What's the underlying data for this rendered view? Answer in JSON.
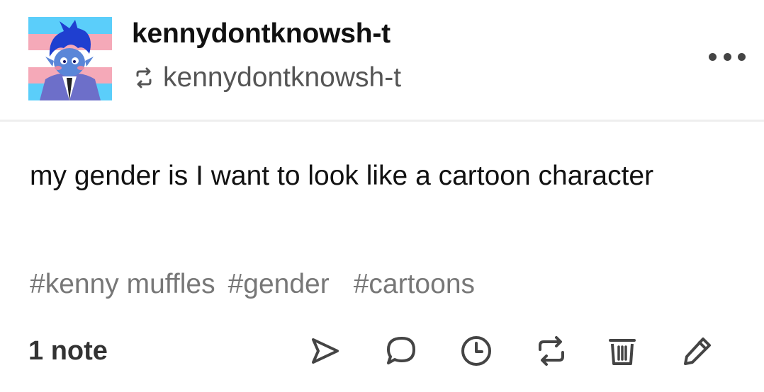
{
  "post": {
    "blog_name": "kennydontknowsh-t",
    "reblogged_from": "kennydontknowsh-t",
    "body_text": "my gender is I want to look like a cartoon character",
    "tags": [
      "#kenny muffles",
      "#gender",
      "#cartoons"
    ],
    "notes_label": "1 note"
  },
  "icons": {
    "avatar": "avatar-cartoon-character-on-trans-flag",
    "reblog": "reblog-icon",
    "more": "more-options-icon",
    "share": "send-icon",
    "reply": "speech-bubble-icon",
    "queue": "clock-icon",
    "reblog_action": "reblog-icon",
    "delete": "trash-icon",
    "edit": "pencil-icon"
  },
  "colors": {
    "trans_blue": "#5bcefa",
    "trans_pink": "#f5a9b8",
    "text": "#111111",
    "muted": "#777777",
    "icon": "#444444"
  }
}
